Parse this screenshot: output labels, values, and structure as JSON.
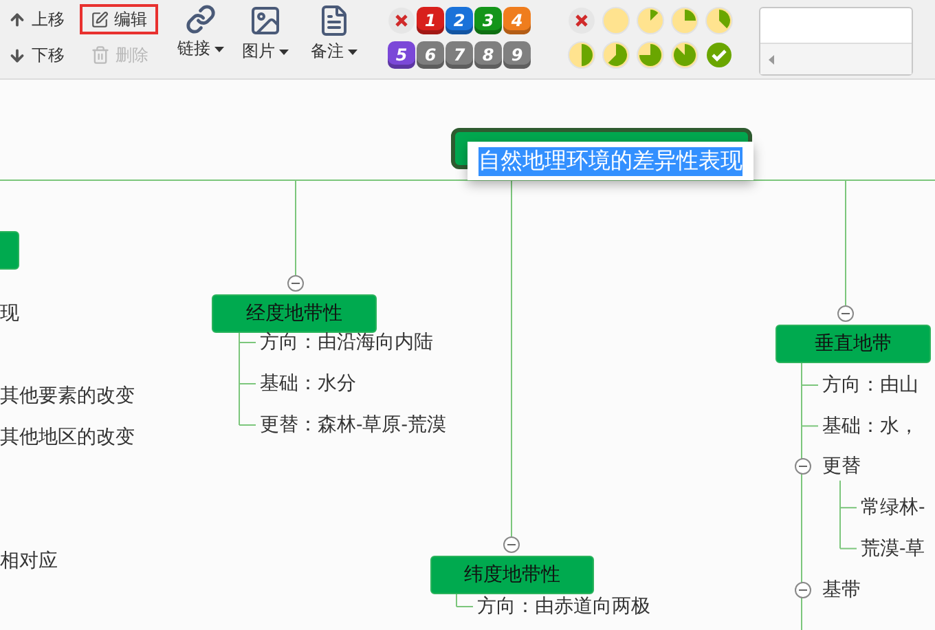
{
  "toolbar": {
    "move": [
      {
        "label": "上移",
        "kind": "up"
      },
      {
        "label": "下移",
        "kind": "down"
      }
    ],
    "edit": [
      {
        "label": "编辑",
        "kind": "edit",
        "disabled": false,
        "highlighted": true
      },
      {
        "label": "删除",
        "kind": "delete",
        "disabled": true,
        "highlighted": false
      }
    ],
    "menus": [
      {
        "label": "链接",
        "kind": "link"
      },
      {
        "label": "图片",
        "kind": "image"
      },
      {
        "label": "备注",
        "kind": "note"
      }
    ],
    "priorities": [
      {
        "kind": "clear"
      },
      {
        "kind": "number",
        "label": "1",
        "color": "#d8201c"
      },
      {
        "kind": "number",
        "label": "2",
        "color": "#1a72d9"
      },
      {
        "kind": "number",
        "label": "3",
        "color": "#14951a"
      },
      {
        "kind": "number",
        "label": "4",
        "color": "#ef7d1e"
      },
      {
        "kind": "number",
        "label": "5",
        "color": "#7b48d8"
      },
      {
        "kind": "number",
        "label": "6",
        "color": "#7d7d7d"
      },
      {
        "kind": "number",
        "label": "7",
        "color": "#7e7e7e"
      },
      {
        "kind": "number",
        "label": "8",
        "color": "#7f7f7f"
      },
      {
        "kind": "number",
        "label": "9",
        "color": "#808080"
      }
    ],
    "progress": [
      {
        "kind": "clear"
      },
      {
        "kind": "none"
      },
      {
        "kind": "eighth"
      },
      {
        "kind": "quarter"
      },
      {
        "kind": "three-eighths"
      },
      {
        "kind": "half"
      },
      {
        "kind": "five-eighths"
      },
      {
        "kind": "three-quarters"
      },
      {
        "kind": "seven-eighths"
      },
      {
        "kind": "done"
      }
    ]
  },
  "mindmap": {
    "root": {
      "text": "自然地理环境的差异性表现",
      "editing": true
    },
    "left_items": [
      "现",
      "其他要素的改变",
      "其他地区的改变",
      "相对应"
    ],
    "branches": [
      {
        "text": "经度地带性",
        "expanded": true,
        "children": [
          {
            "text": "方向：由沿海向内陆"
          },
          {
            "text": "基础：水分"
          },
          {
            "text": "更替：森林-草原-荒漠"
          }
        ]
      },
      {
        "text": "纬度地带性",
        "expanded": true,
        "children": [
          {
            "text": "方向：由赤道向两极"
          }
        ]
      },
      {
        "text": "垂直地带",
        "expanded": true,
        "children": [
          {
            "text": "方向：由山"
          },
          {
            "text": "基础：水，"
          },
          {
            "text": "更替",
            "expanded": true,
            "children": [
              {
                "text": "常绿林-"
              },
              {
                "text": "荒漠-草"
              }
            ]
          },
          {
            "text": "基带",
            "expanded": true
          }
        ]
      }
    ]
  }
}
